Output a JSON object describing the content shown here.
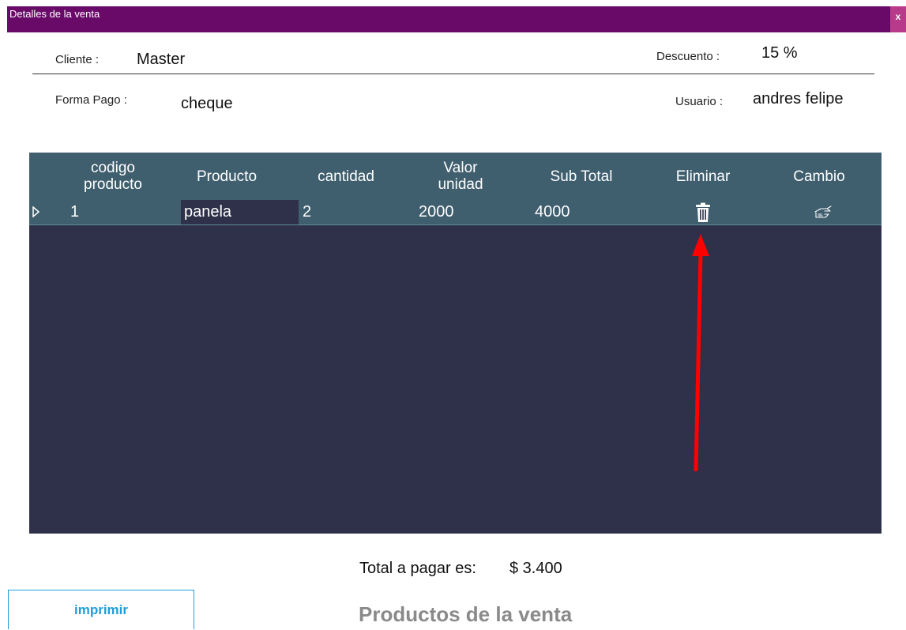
{
  "window": {
    "title": "Detalles de la venta",
    "close_label": "x"
  },
  "info": {
    "cliente_label": "Cliente :",
    "cliente_value": "Master",
    "descuento_label": "Descuento :",
    "descuento_value": "15 %",
    "forma_pago_label": "Forma Pago :",
    "forma_pago_value": "cheque",
    "usuario_label": "Usuario :",
    "usuario_value": "andres felipe"
  },
  "grid": {
    "columns": {
      "codigo_l1": "codigo",
      "codigo_l2": "producto",
      "producto": "Producto",
      "cantidad": "cantidad",
      "valor_l1": "Valor",
      "valor_l2": "unidad",
      "subtotal": "Sub Total",
      "eliminar": "Eliminar",
      "cambio": "Cambio"
    },
    "rows": [
      {
        "codigo": "1",
        "producto": "panela",
        "cantidad": "2",
        "valor": "2000",
        "subtotal": "4000",
        "eliminar_icon": "trash-icon",
        "cambio_icon": "hand-pointer-icon"
      }
    ]
  },
  "total": {
    "label": "Total a pagar es:",
    "value": "$ 3.400"
  },
  "buttons": {
    "imprimir": "imprimir"
  },
  "footer_title": "Productos de la venta",
  "colors": {
    "titlebar": "#690a69",
    "grid_header": "#3f5e6e",
    "grid_body": "#2e3149",
    "accent_button": "#1e9fd8",
    "annotation_arrow": "#ff0000"
  }
}
